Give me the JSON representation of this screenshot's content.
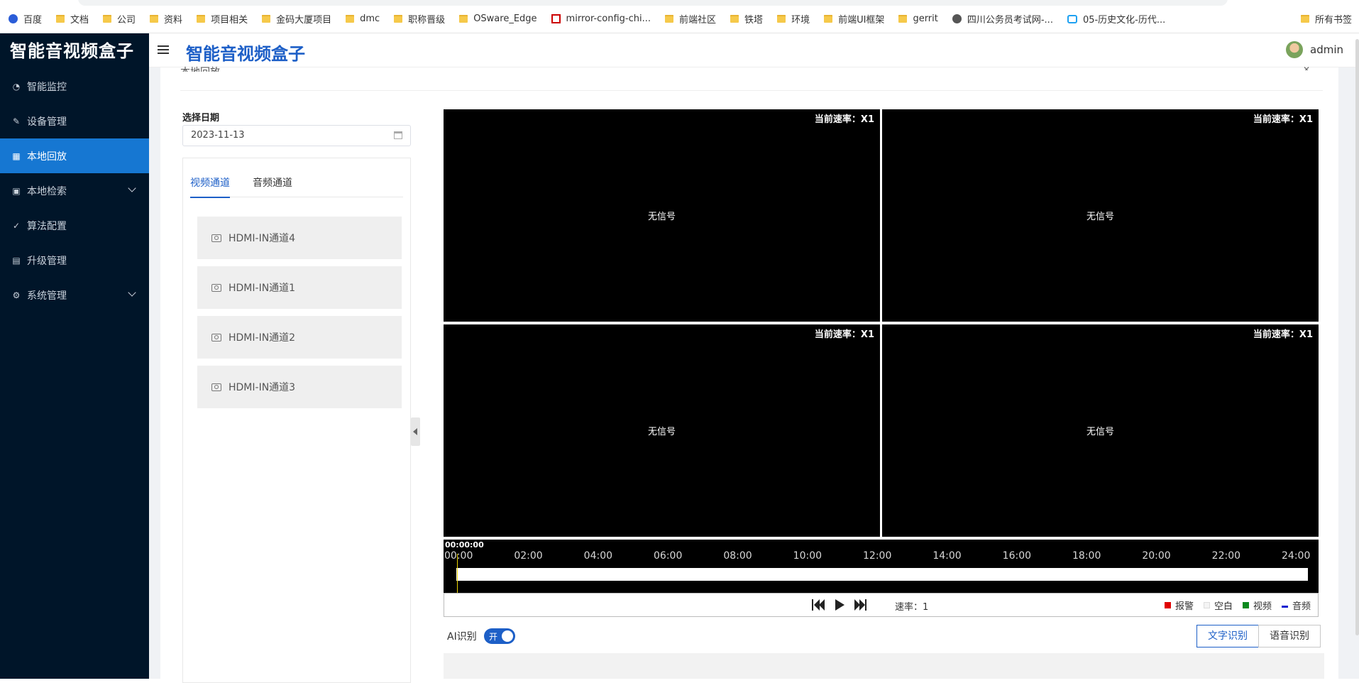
{
  "bookmarks": {
    "items": [
      {
        "label": "百度",
        "icon": "paw-icon"
      },
      {
        "label": "文档",
        "icon": "folder-icon"
      },
      {
        "label": "公司",
        "icon": "folder-icon"
      },
      {
        "label": "资料",
        "icon": "folder-icon"
      },
      {
        "label": "项目相关",
        "icon": "folder-icon"
      },
      {
        "label": "金码大厦项目",
        "icon": "folder-icon"
      },
      {
        "label": "dmc",
        "icon": "folder-icon"
      },
      {
        "label": "职称晋级",
        "icon": "folder-icon"
      },
      {
        "label": "OSware_Edge",
        "icon": "folder-icon"
      },
      {
        "label": "mirror-config-chi...",
        "icon": "red-square-icon"
      },
      {
        "label": "前端社区",
        "icon": "folder-icon"
      },
      {
        "label": "铁塔",
        "icon": "folder-icon"
      },
      {
        "label": "环境",
        "icon": "folder-icon"
      },
      {
        "label": "前端UI框架",
        "icon": "folder-icon"
      },
      {
        "label": "gerrit",
        "icon": "folder-icon"
      },
      {
        "label": "四川公务员考试网-...",
        "icon": "globe-icon"
      },
      {
        "label": "05-历史文化-历代...",
        "icon": "tv-icon"
      }
    ],
    "all_bookmarks": "所有书签"
  },
  "sidebar": {
    "logo": "智能音视频盒子",
    "items": [
      {
        "label": "智能监控",
        "icon": "dashboard-icon",
        "active": false,
        "submenu": false
      },
      {
        "label": "设备管理",
        "icon": "edit-icon",
        "active": false,
        "submenu": false
      },
      {
        "label": "本地回放",
        "icon": "table-icon",
        "active": true,
        "submenu": false
      },
      {
        "label": "本地检索",
        "icon": "calendar-icon",
        "active": false,
        "submenu": true
      },
      {
        "label": "算法配置",
        "icon": "check-circle-icon",
        "active": false,
        "submenu": false
      },
      {
        "label": "升级管理",
        "icon": "document-icon",
        "active": false,
        "submenu": false
      },
      {
        "label": "系统管理",
        "icon": "gear-icon",
        "active": false,
        "submenu": true
      }
    ]
  },
  "header": {
    "title": "智能音视频盒子",
    "user": "admin"
  },
  "card": {
    "title": "本地回放"
  },
  "filter": {
    "date_label": "选择日期",
    "date_value": "2023-11-13"
  },
  "channels": {
    "tabs": [
      {
        "label": "视频通道",
        "active": true
      },
      {
        "label": "音频通道",
        "active": false
      }
    ],
    "items": [
      "HDMI-IN通道4",
      "HDMI-IN通道1",
      "HDMI-IN通道2",
      "HDMI-IN通道3"
    ]
  },
  "videos": [
    {
      "speed": "当前速率：X1",
      "status": "无信号"
    },
    {
      "speed": "当前速率：X1",
      "status": "无信号"
    },
    {
      "speed": "当前速率：X1",
      "status": "无信号"
    },
    {
      "speed": "当前速率：X1",
      "status": "无信号"
    }
  ],
  "timeline": {
    "current_time": "00:00:00",
    "ticks": [
      "00:00",
      "02:00",
      "04:00",
      "06:00",
      "08:00",
      "10:00",
      "12:00",
      "14:00",
      "16:00",
      "18:00",
      "20:00",
      "22:00",
      "24:00"
    ]
  },
  "controls": {
    "rate_label": "速率：",
    "rate_value": "1",
    "legend": [
      {
        "label": "报警",
        "color": "#e00000"
      },
      {
        "label": "空白",
        "color": "#f4f4f4"
      },
      {
        "label": "视频",
        "color": "#0b8a1e"
      },
      {
        "label": "音频",
        "color": "#1020d0"
      }
    ]
  },
  "ai": {
    "label": "AI识别",
    "switch_text": "开",
    "switch_on": true,
    "buttons": [
      {
        "label": "文字识别",
        "active": true
      },
      {
        "label": "语音识别",
        "active": false
      }
    ]
  }
}
